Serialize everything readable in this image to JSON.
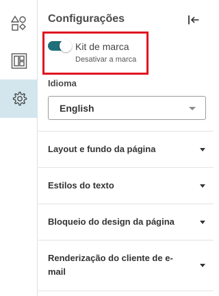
{
  "rail": {
    "items": [
      {
        "icon": "shapes-icon",
        "active": false
      },
      {
        "icon": "layout-icon",
        "active": false
      },
      {
        "icon": "settings-gear-icon",
        "active": true
      }
    ]
  },
  "panel": {
    "title": "Configurações",
    "collapse_icon": "collapse-left-icon"
  },
  "brand_kit": {
    "label": "Kit de marca",
    "sublabel": "Desativar a marca",
    "enabled": true
  },
  "language": {
    "label": "Idioma",
    "selected": "English"
  },
  "sections": [
    {
      "label": "Layout e fundo da página"
    },
    {
      "label": "Estilos do texto"
    },
    {
      "label": "Bloqueio do design da página"
    },
    {
      "label": "Renderização do cliente de e-mail"
    }
  ],
  "colors": {
    "accent": "#1f6f7a",
    "active_rail_bg": "#d3e6ee",
    "highlight": "#e0101e"
  }
}
